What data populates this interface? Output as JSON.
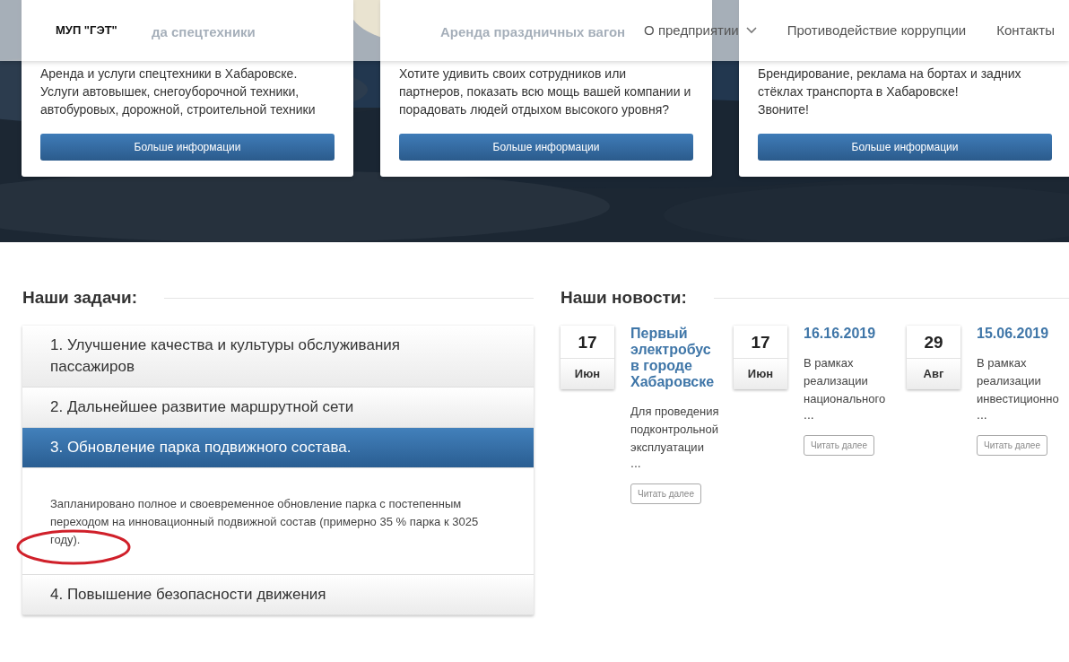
{
  "navbar": {
    "logo": "МУП \"ГЭТ\"",
    "links": [
      {
        "label": "О предприятии",
        "dropdown": true
      },
      {
        "label": "Противодействие коррупции",
        "dropdown": false
      },
      {
        "label": "Контакты",
        "dropdown": false
      }
    ]
  },
  "service_cards": [
    {
      "title": "да спецтехники",
      "text": "Аренда и услуги спецтехники в Хабаровске.\nУслуги автовышек, снегоуборочной техники,\nавтобуровых, дорожной, строительной техники",
      "button": "Больше информации"
    },
    {
      "title": "Аренда праздничных вагон",
      "text": "Хотите удивить своих сотрудников или\nпартнеров, показать всю мощь вашей компании и\nпорадовать людей отдыхом высокого уровня?",
      "button": "Больше информации"
    },
    {
      "text": "Брендирование, реклама на бортах и задних\nстёклах транспорта в Хабаровске!\nЗвоните!",
      "button": "Больше информации"
    }
  ],
  "tasks": {
    "heading": "Наши задачи:",
    "items": [
      {
        "title": "1. Улучшение качества и культуры обслуживания пассажиров",
        "expanded": false
      },
      {
        "title": "2. Дальнейшее развитие маршрутной сети",
        "expanded": false
      },
      {
        "title": "3. Обновление парка подвижного состава.",
        "expanded": true,
        "body": "Запланировано полное и своевременное обновление парка с постепенным переходом на инновационный подвижной состав (примерно 35 % парка к 3025 году)."
      },
      {
        "title": "4. Повышение безопасности движения",
        "expanded": false
      }
    ]
  },
  "news": {
    "heading": "Наши новости:",
    "items": [
      {
        "day": "17",
        "month": "Июн",
        "title": "Первый электробус в городе Хабаровске",
        "excerpt": "Для проведения подконтрольной эксплуатации",
        "ellipsis": "...",
        "button": "Читать далее"
      },
      {
        "day": "17",
        "month": "Июн",
        "title": "16.16.2019",
        "excerpt": "В рамках реализации национального",
        "ellipsis": "...",
        "button": "Читать далее"
      },
      {
        "day": "29",
        "month": "Авг",
        "title": "15.06.2019",
        "excerpt": "В рамках реализации инвестиционно",
        "ellipsis": "...",
        "button": "Читать далее"
      }
    ]
  }
}
